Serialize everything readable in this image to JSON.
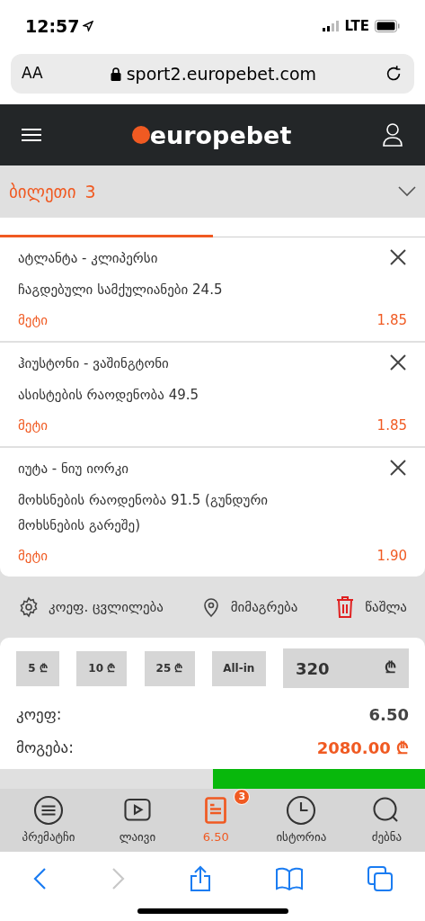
{
  "status_bar": {
    "time": "12:57",
    "network": "LTE"
  },
  "address_bar": {
    "text_size": "AA",
    "url": "sport2.europebet.com"
  },
  "header": {
    "logo": "europebet"
  },
  "ticket": {
    "title": "ბილეთი",
    "count": "3",
    "expanded": true
  },
  "tabs": [
    {
      "selected": true
    },
    {
      "selected": false
    }
  ],
  "bets": [
    {
      "match": "ატლანტა - კლიპერსი",
      "market": "ჩაგდებული სამქულიანები 24.5",
      "pick": "მეტი",
      "odds": "1.85"
    },
    {
      "match": "ჰიუსტონი - ვაშინგტონი",
      "market": "ასისტების რაოდენობა 49.5",
      "pick": "მეტი",
      "odds": "1.85"
    },
    {
      "match": "იუტა - ნიუ იორკი",
      "market": "მოხსნების რაოდენობა 91.5 (გუნდური მოხსნების გარეშე)",
      "pick": "მეტი",
      "odds": "1.90"
    }
  ],
  "actions": [
    {
      "kind": "settings",
      "label": "კოეფ. ცვლილება"
    },
    {
      "kind": "pin",
      "label": "მიმაგრება"
    },
    {
      "kind": "delete",
      "label": "წაშლა"
    }
  ],
  "stake_buttons": [
    "5 ₾",
    "10 ₾",
    "25 ₾",
    "All-in"
  ],
  "stake": {
    "value": "320",
    "currency": "₾"
  },
  "summary": [
    {
      "label": "კოეფ:",
      "value": "6.50",
      "highlight": false
    },
    {
      "label": "მოგება:",
      "value": "2080.00 ₾",
      "highlight": true
    }
  ],
  "bottom_nav": [
    {
      "kind": "list",
      "label": "პრემატჩი",
      "selected": false
    },
    {
      "kind": "play",
      "label": "ლაივი",
      "selected": false
    },
    {
      "kind": "ticket",
      "label": "6.50",
      "selected": true,
      "badge": "3"
    },
    {
      "kind": "clock",
      "label": "ისტორია",
      "selected": false
    },
    {
      "kind": "search",
      "label": "ძებნა",
      "selected": false
    }
  ]
}
